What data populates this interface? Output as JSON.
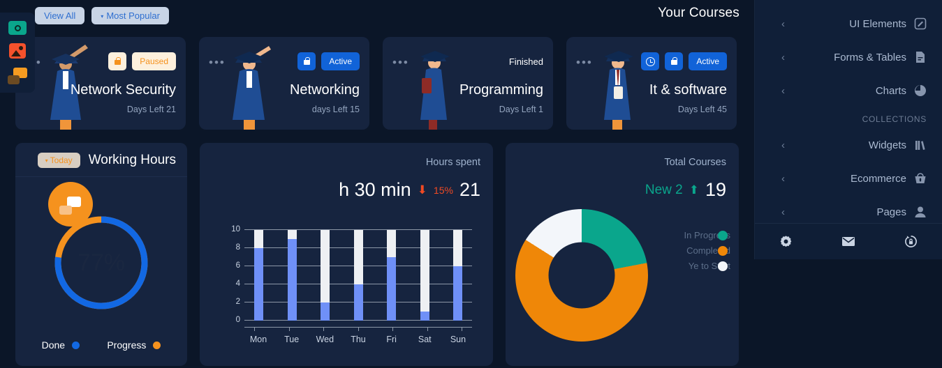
{
  "colors": {
    "page_bg": "#0b1628",
    "card_bg": "#16243f",
    "sidebar_bg": "#101f38",
    "accent_blue": "#1163d8",
    "accent_orange": "#f5921e",
    "accent_teal": "#0aa68c",
    "danger_red": "#f04a23",
    "bar_blue": "#6f90f7",
    "bar_track": "#eef0f3"
  },
  "icon_rail": {
    "items": [
      {
        "name": "money-icon"
      },
      {
        "name": "image-icon"
      },
      {
        "name": "chat-icon"
      }
    ]
  },
  "toolbar": {
    "view_all_label": "View All",
    "most_popular_label": "Most Popular",
    "caret": "▾"
  },
  "courses_section": {
    "title": "Your Courses",
    "cards": [
      {
        "name": "Network Security",
        "days_left": "Days Left 21",
        "status": "Paused",
        "status_style": "cream",
        "has_lock": true,
        "lock_style": "cream",
        "has_clock": false,
        "dots": "•••"
      },
      {
        "name": "Networking",
        "days_left": "days Left 15",
        "status": "Active",
        "status_style": "blue",
        "has_lock": true,
        "lock_style": "blue",
        "has_clock": false,
        "dots": "•••"
      },
      {
        "name": "Programming",
        "days_left": "Days Left 1",
        "status": "Finished",
        "status_style": "plain",
        "has_lock": false,
        "lock_style": "",
        "has_clock": false,
        "dots": "•••"
      },
      {
        "name": "It & software",
        "days_left": "Days Left 45",
        "status": "Active",
        "status_style": "blue",
        "has_lock": true,
        "lock_style": "blue",
        "has_clock": true,
        "dots": "•••"
      }
    ]
  },
  "working_hours": {
    "title": "Working Hours",
    "range_label": "Today",
    "caret": "▾",
    "percent": "77%",
    "legend": [
      {
        "label": "Done",
        "color": "#1268e3"
      },
      {
        "label": "Progress",
        "color": "#f5921e"
      }
    ]
  },
  "hours_spent": {
    "title": "Hours spent",
    "value": "h 30 min",
    "delta": "15%",
    "delta_arrow": "⬇",
    "count": "21"
  },
  "total_courses": {
    "title": "Total Courses",
    "new_label": "New 2",
    "arrow": "⬆",
    "count": "19",
    "legend": [
      {
        "label": "In Progress",
        "color": "#0aa68c"
      },
      {
        "label": "Completed",
        "color": "#ef8708"
      },
      {
        "label": "Ye to Start",
        "color": "#f3f6fa"
      }
    ]
  },
  "sidebar": {
    "items": [
      {
        "label": "UI Elements",
        "icon": "pencil-square-icon",
        "chevron": "‹"
      },
      {
        "label": "Forms & Tables",
        "icon": "document-icon",
        "chevron": "‹"
      },
      {
        "label": "Charts",
        "icon": "pie-chart-icon",
        "chevron": "‹"
      }
    ],
    "section_label": "COLLECTIONS",
    "collection_items": [
      {
        "label": "Widgets",
        "icon": "books-icon",
        "chevron": "‹"
      },
      {
        "label": "Ecommerce",
        "icon": "basket-icon",
        "chevron": "‹"
      },
      {
        "label": "Pages",
        "icon": "person-icon",
        "chevron": "‹"
      }
    ],
    "footer_icons": [
      {
        "name": "gear-icon"
      },
      {
        "name": "mail-icon"
      },
      {
        "name": "lock-refresh-icon"
      }
    ]
  },
  "chart_data": [
    {
      "type": "bar",
      "title": "Hours spent",
      "categories": [
        "Mon",
        "Tue",
        "Wed",
        "Thu",
        "Fri",
        "Sat",
        "Sun"
      ],
      "values": [
        8,
        9,
        2,
        4,
        7,
        1,
        6
      ],
      "track_max": 10,
      "yticks": [
        0,
        2,
        4,
        6,
        8,
        10
      ],
      "ylim": [
        0,
        10
      ],
      "xlabel": "",
      "ylabel": "",
      "grid": true,
      "series_color": "#6f90f7",
      "track_color": "#eef0f3"
    },
    {
      "type": "pie",
      "title": "Total Courses",
      "labels": [
        "In Progress",
        "Completed",
        "Ye to Start"
      ],
      "values": [
        22,
        62,
        16
      ],
      "colors": [
        "#0aa68c",
        "#ef8708",
        "#f3f6fa"
      ],
      "donut": true,
      "legend": "right"
    },
    {
      "type": "pie",
      "title": "Working Hours",
      "labels": [
        "Done",
        "Progress"
      ],
      "values": [
        77,
        23
      ],
      "colors": [
        "#1268e3",
        "#f5921e"
      ],
      "donut": true,
      "center_label": "77%",
      "legend": "bottom"
    }
  ]
}
